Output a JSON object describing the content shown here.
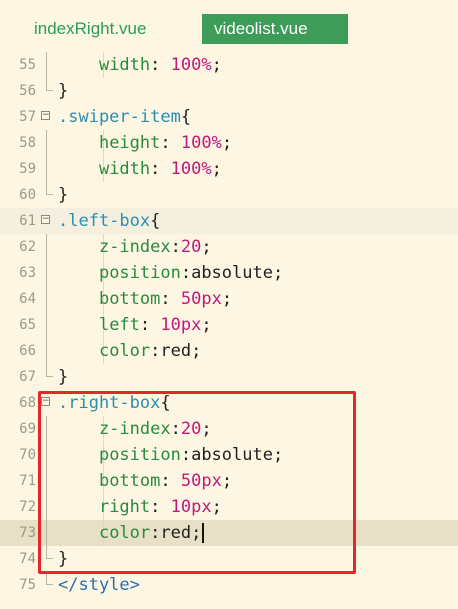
{
  "tabs": [
    {
      "label": "indexRight.vue",
      "active": false
    },
    {
      "label": "videolist.vue",
      "active": true
    }
  ],
  "colors": {
    "active_tab": "#3d9c58",
    "highlight_box": "#e8262a",
    "selector": "#2a8fb0",
    "property": "#2a8a3f",
    "number": "#c2187a"
  },
  "lines": [
    {
      "num": "55",
      "indent": "    ",
      "fold": "line",
      "tokens": [
        {
          "t": "width",
          "c": "prop"
        },
        {
          "t": ": ",
          "c": "p"
        },
        {
          "t": "100%",
          "c": "num"
        },
        {
          "t": ";",
          "c": "p"
        }
      ]
    },
    {
      "num": "56",
      "indent": "",
      "fold": "end",
      "tokens": [
        {
          "t": "}",
          "c": "p"
        }
      ]
    },
    {
      "num": "57",
      "indent": "",
      "fold": "box",
      "tokens": [
        {
          "t": ".swiper-item",
          "c": "sel"
        },
        {
          "t": "{",
          "c": "p"
        }
      ]
    },
    {
      "num": "58",
      "indent": "    ",
      "fold": "line",
      "tokens": [
        {
          "t": "height",
          "c": "prop"
        },
        {
          "t": ": ",
          "c": "p"
        },
        {
          "t": "100%",
          "c": "num"
        },
        {
          "t": ";",
          "c": "p"
        }
      ]
    },
    {
      "num": "59",
      "indent": "    ",
      "fold": "line",
      "tokens": [
        {
          "t": "width",
          "c": "prop"
        },
        {
          "t": ": ",
          "c": "p"
        },
        {
          "t": "100%",
          "c": "num"
        },
        {
          "t": ";",
          "c": "p"
        }
      ]
    },
    {
      "num": "60",
      "indent": "",
      "fold": "end",
      "tokens": [
        {
          "t": "}",
          "c": "p"
        }
      ]
    },
    {
      "num": "61",
      "indent": "",
      "fold": "box",
      "tokens": [
        {
          "t": ".left-box",
          "c": "sel"
        },
        {
          "t": "{",
          "c": "p"
        }
      ]
    },
    {
      "num": "62",
      "indent": "    ",
      "fold": "line",
      "tokens": [
        {
          "t": "z-index",
          "c": "prop"
        },
        {
          "t": ":",
          "c": "p"
        },
        {
          "t": "20",
          "c": "num"
        },
        {
          "t": ";",
          "c": "p"
        }
      ]
    },
    {
      "num": "63",
      "indent": "    ",
      "fold": "line",
      "tokens": [
        {
          "t": "position",
          "c": "prop"
        },
        {
          "t": ":absolute;",
          "c": "p"
        }
      ]
    },
    {
      "num": "64",
      "indent": "    ",
      "fold": "line",
      "tokens": [
        {
          "t": "bottom",
          "c": "prop"
        },
        {
          "t": ": ",
          "c": "p"
        },
        {
          "t": "50",
          "c": "num"
        },
        {
          "t": "px",
          "c": "unit"
        },
        {
          "t": ";",
          "c": "p"
        }
      ]
    },
    {
      "num": "65",
      "indent": "    ",
      "fold": "line",
      "tokens": [
        {
          "t": "left",
          "c": "prop"
        },
        {
          "t": ": ",
          "c": "p"
        },
        {
          "t": "10",
          "c": "num"
        },
        {
          "t": "px",
          "c": "unit"
        },
        {
          "t": ";",
          "c": "p"
        }
      ]
    },
    {
      "num": "66",
      "indent": "    ",
      "fold": "line",
      "tokens": [
        {
          "t": "color",
          "c": "prop"
        },
        {
          "t": ":red;",
          "c": "p"
        }
      ]
    },
    {
      "num": "67",
      "indent": "",
      "fold": "end",
      "tokens": [
        {
          "t": "}",
          "c": "p"
        }
      ]
    },
    {
      "num": "68",
      "indent": "",
      "fold": "box",
      "tokens": [
        {
          "t": ".right-box",
          "c": "sel"
        },
        {
          "t": "{",
          "c": "p"
        }
      ]
    },
    {
      "num": "69",
      "indent": "    ",
      "fold": "line",
      "tokens": [
        {
          "t": "z-index",
          "c": "prop"
        },
        {
          "t": ":",
          "c": "p"
        },
        {
          "t": "20",
          "c": "num"
        },
        {
          "t": ";",
          "c": "p"
        }
      ]
    },
    {
      "num": "70",
      "indent": "    ",
      "fold": "line",
      "tokens": [
        {
          "t": "position",
          "c": "prop"
        },
        {
          "t": ":absolute;",
          "c": "p"
        }
      ]
    },
    {
      "num": "71",
      "indent": "    ",
      "fold": "line",
      "tokens": [
        {
          "t": "bottom",
          "c": "prop"
        },
        {
          "t": ": ",
          "c": "p"
        },
        {
          "t": "50",
          "c": "num"
        },
        {
          "t": "px",
          "c": "unit"
        },
        {
          "t": ";",
          "c": "p"
        }
      ]
    },
    {
      "num": "72",
      "indent": "    ",
      "fold": "line",
      "tokens": [
        {
          "t": "right",
          "c": "prop"
        },
        {
          "t": ": ",
          "c": "p"
        },
        {
          "t": "10",
          "c": "num"
        },
        {
          "t": "px",
          "c": "unit"
        },
        {
          "t": ";",
          "c": "p"
        }
      ]
    },
    {
      "num": "73",
      "indent": "    ",
      "fold": "line",
      "current": true,
      "tokens": [
        {
          "t": "color",
          "c": "prop"
        },
        {
          "t": ":red;",
          "c": "p"
        }
      ]
    },
    {
      "num": "74",
      "indent": "",
      "fold": "end",
      "tokens": [
        {
          "t": "}",
          "c": "p"
        }
      ]
    },
    {
      "num": "75",
      "indent": "",
      "fold": "end",
      "tokens": [
        {
          "t": "</style>",
          "c": "tag"
        }
      ]
    }
  ]
}
